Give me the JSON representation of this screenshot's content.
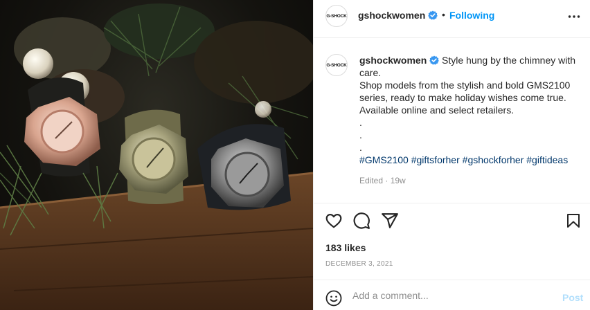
{
  "photo": {
    "alt_icon": "post-photo"
  },
  "header": {
    "avatar_text": "G-SHOCK",
    "username": "gshockwomen",
    "separator": "•",
    "follow_label": "Following"
  },
  "caption": {
    "avatar_text": "G-SHOCK",
    "username": "gshockwomen",
    "line1": "Style hung by the chimney with care.",
    "line2": "Shop models from the stylish and bold GMS2100 series, ready to make holiday wishes come true.",
    "line3": "Available online and select retailers.",
    "dots": [
      ".",
      ".",
      "."
    ],
    "hashtags": [
      "#GMS2100",
      "#giftsforher",
      "#gshockforher",
      "#giftideas"
    ],
    "edited": "Edited · 19w"
  },
  "actions": {
    "like_icon": "heart-icon",
    "comment_icon": "comment-icon",
    "share_icon": "paper-plane-icon",
    "save_icon": "bookmark-icon"
  },
  "likes": "183 likes",
  "date": "DECEMBER 3, 2021",
  "comment": {
    "placeholder": "Add a comment...",
    "post_label": "Post"
  },
  "colors": {
    "accent": "#0095f6",
    "hashtag": "#00376b",
    "muted": "#8e8e8e",
    "post_disabled": "#b2dffc"
  }
}
